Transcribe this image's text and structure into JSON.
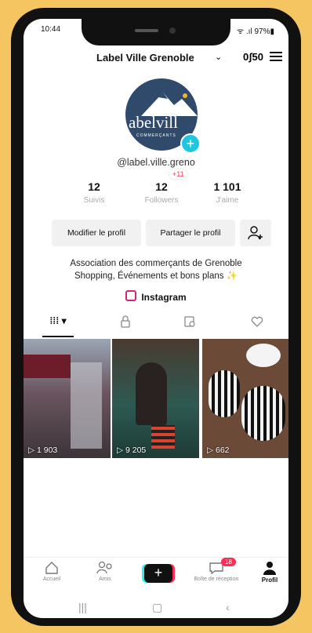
{
  "status": {
    "time": "10:44",
    "battery": "97%"
  },
  "header": {
    "title": "Label Ville Grenoble",
    "icon_label": "0ʃ50"
  },
  "profile": {
    "handle": "@label.ville.greno",
    "logo_text": "abelvill",
    "logo_sub": "COMMERÇANTS",
    "stats": [
      {
        "num": "12",
        "label": "Suivis"
      },
      {
        "num": "12",
        "label": "Followers",
        "bubble": "+11"
      },
      {
        "num": "1 101",
        "label": "J'aime"
      }
    ],
    "buttons": {
      "edit": "Modifier le profil",
      "share": "Partager le profil"
    },
    "bio_line1": "Association des commerçants de Grenoble",
    "bio_line2": "Shopping, Événements et bons plans ✨",
    "instagram": "Instagram"
  },
  "videos": [
    {
      "views": "1 903"
    },
    {
      "views": "9 205"
    },
    {
      "views": "662"
    }
  ],
  "bottom_nav": {
    "home": "Accueil",
    "friends": "Amis",
    "inbox": "Boîte de réception",
    "inbox_badge": "18",
    "profile": "Profil"
  }
}
